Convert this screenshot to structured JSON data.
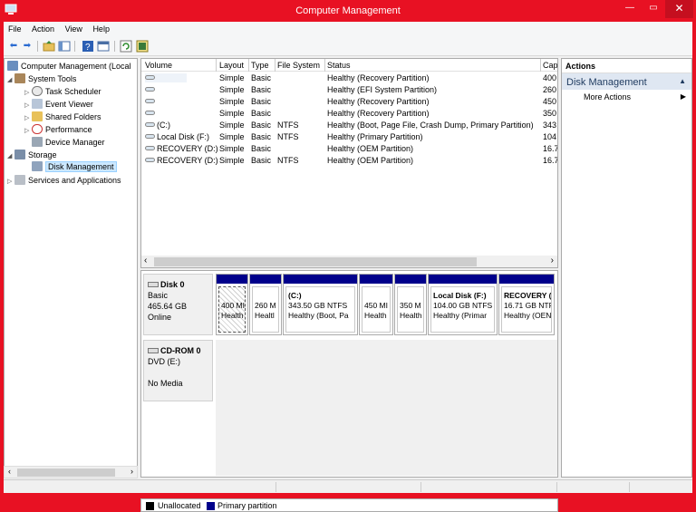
{
  "window": {
    "title": "Computer Management",
    "accent": "#e81123",
    "min_label": "—",
    "max_label": "▭",
    "close_label": "✕"
  },
  "menu": {
    "file": "File",
    "action": "Action",
    "view": "View",
    "help": "Help"
  },
  "tree": {
    "root": "Computer Management (Local",
    "system_tools": "System Tools",
    "task_scheduler": "Task Scheduler",
    "event_viewer": "Event Viewer",
    "shared_folders": "Shared Folders",
    "performance": "Performance",
    "device_manager": "Device Manager",
    "storage": "Storage",
    "disk_management": "Disk Management",
    "services_apps": "Services and Applications"
  },
  "volumes": {
    "columns": [
      "Volume",
      "Layout",
      "Type",
      "File System",
      "Status",
      "Cap"
    ],
    "rows": [
      {
        "volume": "",
        "layout": "Simple",
        "type": "Basic",
        "fs": "",
        "status": "Healthy (Recovery Partition)",
        "cap": "400"
      },
      {
        "volume": "",
        "layout": "Simple",
        "type": "Basic",
        "fs": "",
        "status": "Healthy (EFI System Partition)",
        "cap": "260"
      },
      {
        "volume": "",
        "layout": "Simple",
        "type": "Basic",
        "fs": "",
        "status": "Healthy (Recovery Partition)",
        "cap": "450"
      },
      {
        "volume": "",
        "layout": "Simple",
        "type": "Basic",
        "fs": "",
        "status": "Healthy (Recovery Partition)",
        "cap": "350"
      },
      {
        "volume": "(C:)",
        "layout": "Simple",
        "type": "Basic",
        "fs": "NTFS",
        "status": "Healthy (Boot, Page File, Crash Dump, Primary Partition)",
        "cap": "343"
      },
      {
        "volume": "Local Disk (F:)",
        "layout": "Simple",
        "type": "Basic",
        "fs": "NTFS",
        "status": "Healthy (Primary Partition)",
        "cap": "104"
      },
      {
        "volume": "RECOVERY (D:)",
        "layout": "Simple",
        "type": "Basic",
        "fs": "",
        "status": "Healthy (OEM Partition)",
        "cap": "16.7"
      },
      {
        "volume": "RECOVERY (D:)",
        "layout": "Simple",
        "type": "Basic",
        "fs": "NTFS",
        "status": "Healthy (OEM Partition)",
        "cap": "16.7"
      }
    ]
  },
  "disk0": {
    "name": "Disk 0",
    "type": "Basic",
    "size": "465.64 GB",
    "state": "Online",
    "partitions": [
      {
        "name": "",
        "size": "400 MI",
        "status": "Health"
      },
      {
        "name": "",
        "size": "260 M",
        "status": "Healtl"
      },
      {
        "name": "(C:)",
        "size": "343.50 GB NTFS",
        "status": "Healthy (Boot, Pa"
      },
      {
        "name": "",
        "size": "450 MI",
        "status": "Health"
      },
      {
        "name": "",
        "size": "350 M",
        "status": "Health"
      },
      {
        "name": "Local Disk  (F:)",
        "size": "104.00 GB NTFS",
        "status": "Healthy (Primar"
      },
      {
        "name": "RECOVERY  (",
        "size": "16.71 GB NTF",
        "status": "Healthy (OEN"
      }
    ]
  },
  "cdrom0": {
    "name": "CD-ROM 0",
    "drive": "DVD (E:)",
    "media": "No Media"
  },
  "legend": {
    "unallocated": "Unallocated",
    "primary": "Primary partition",
    "unallocated_color": "#000000",
    "primary_color": "#00008b"
  },
  "actions": {
    "header": "Actions",
    "section": "Disk Management",
    "more": "More Actions"
  }
}
